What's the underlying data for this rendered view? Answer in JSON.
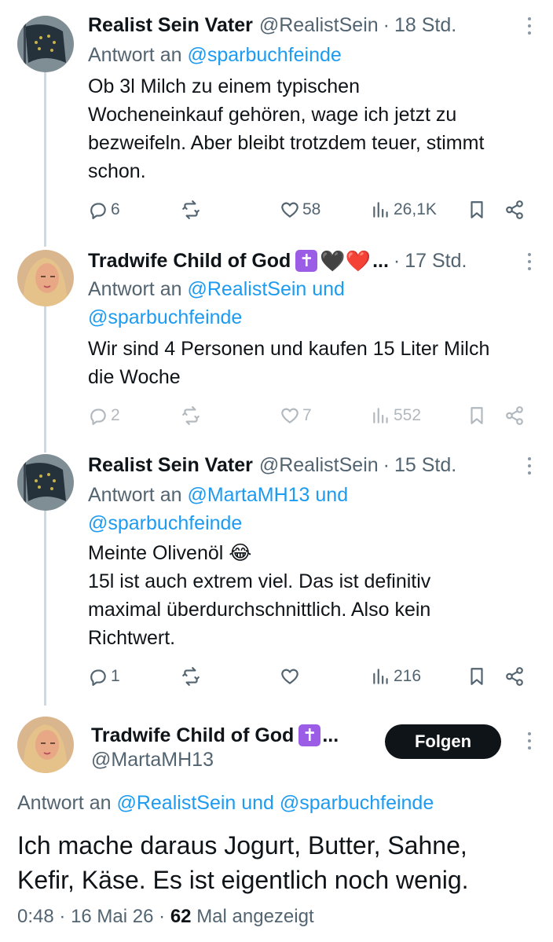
{
  "thread": [
    {
      "name": "Realist Sein Vater",
      "handle": "@RealistSein",
      "time": "18 Std.",
      "reply_prefix": "Antwort an",
      "reply_to_line1": "@sparbuchfeinde",
      "reply_to_line2": "",
      "body": [
        "Ob 3l Milch zu einem typischen",
        "Wocheneinkauf gehören, wage ich jetzt zu",
        "bezweifeln. Aber bleibt trotzdem teuer, stimmt",
        "schon."
      ],
      "replies": "6",
      "retweets": "",
      "likes": "58",
      "views": "26,1K"
    },
    {
      "name": "Tradwife Child of God",
      "name_badge": "✝",
      "name_hearts": "🖤❤️",
      "name_ellipsis": "...",
      "time": "17 Std.",
      "reply_prefix": "Antwort an",
      "reply_to_line1": "@RealistSein und",
      "reply_to_line2": "@sparbuchfeinde",
      "body": [
        "Wir sind 4 Personen und kaufen 15 Liter Milch",
        "die Woche"
      ],
      "replies": "2",
      "retweets": "",
      "likes": "7",
      "views": "552"
    },
    {
      "name": "Realist Sein Vater",
      "handle": "@RealistSein",
      "time": "15 Std.",
      "reply_prefix": "Antwort an",
      "reply_to_line1": "@MartaMH13 und",
      "reply_to_line2": "@sparbuchfeinde",
      "body": [
        "Meinte Olivenöl 😂",
        "15l ist auch extrem viel. Das ist definitiv",
        "maximal überdurchschnittlich. Also kein",
        "Richtwert."
      ],
      "replies": "1",
      "retweets": "",
      "likes": "",
      "views": "216"
    }
  ],
  "main_tweet": {
    "name": "Tradwife Child of God",
    "name_badge": "✝",
    "name_ellipsis": "...",
    "handle": "@MartaMH13",
    "follow_label": "Folgen",
    "reply_prefix": "Antwort an",
    "reply_to": "@RealistSein und @sparbuchfeinde",
    "body": [
      "Ich mache daraus Jogurt, Butter, Sahne,",
      "Kefir, Käse. Es ist eigentlich noch wenig."
    ],
    "time": "0:48",
    "date": "16 Mai 26",
    "view_count": "62",
    "view_label": "Mal angezeigt"
  },
  "icons": {
    "reply": "reply-icon",
    "retweet": "retweet-icon",
    "like": "heart-icon",
    "views": "views-icon",
    "bookmark": "bookmark-icon",
    "share": "share-icon",
    "more": "more-icon"
  },
  "colors": {
    "text": "#0f1419",
    "secondary": "#536471",
    "link": "#1d9bf0",
    "thread_line": "#cfd9de",
    "follow_bg": "#0f1419",
    "badge": "#9b5de5"
  },
  "separator": "·"
}
